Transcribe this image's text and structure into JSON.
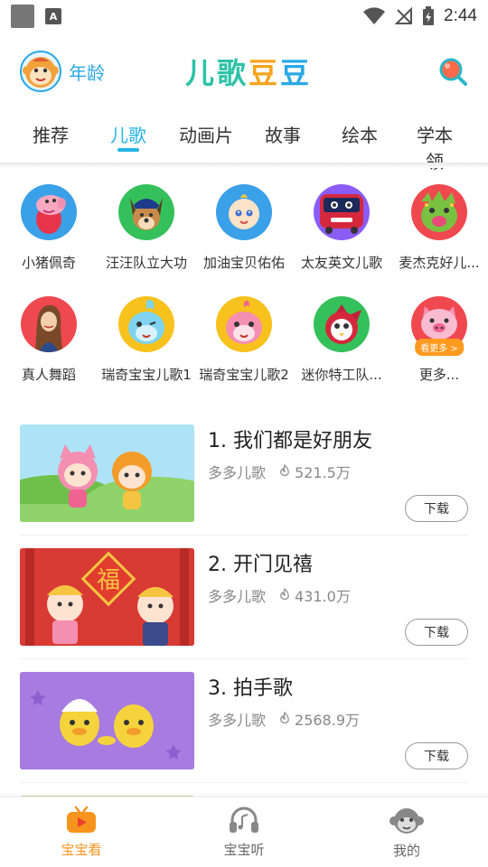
{
  "status": {
    "time": "2:44"
  },
  "header": {
    "age_label": "年龄",
    "logo_chars": [
      "儿",
      "歌",
      "豆",
      "豆"
    ],
    "logo_colors": [
      "#2ec2a6",
      "#2ec2a6",
      "#f7a31d",
      "#2aa8e6"
    ]
  },
  "tabs": [
    {
      "label": "推荐",
      "active": false
    },
    {
      "label": "儿歌",
      "active": true
    },
    {
      "label": "动画片",
      "active": false
    },
    {
      "label": "故事",
      "active": false
    },
    {
      "label": "绘本",
      "active": false
    },
    {
      "label": "学本领",
      "active": false
    }
  ],
  "categories": [
    {
      "label": "小猪佩奇",
      "bg": "#3aa0e8",
      "icon": "peppa-pig-icon"
    },
    {
      "label": "汪汪队立大功",
      "bg": "#34c05a",
      "icon": "paw-patrol-dog-icon"
    },
    {
      "label": "加油宝贝佑佑",
      "bg": "#3aa0e8",
      "icon": "baby-yoyo-icon"
    },
    {
      "label": "太友英文儿歌",
      "bg": "#8b5cf6",
      "icon": "tayo-bus-icon"
    },
    {
      "label": "麦杰克好儿...",
      "bg": "#f0484f",
      "icon": "green-monster-icon"
    },
    {
      "label": "真人舞蹈",
      "bg": "#f0484f",
      "icon": "dancing-girl-icon"
    },
    {
      "label": "瑞奇宝宝儿歌1",
      "bg": "#f7c21d",
      "icon": "rikki-blue-icon"
    },
    {
      "label": "瑞奇宝宝儿歌2",
      "bg": "#f7c21d",
      "icon": "rikki-pink-icon"
    },
    {
      "label": "迷你特工队...",
      "bg": "#34c05a",
      "icon": "mini-force-bird-icon"
    },
    {
      "label": "更多...",
      "bg": "#f0484f",
      "icon": "pink-pig-icon",
      "badge": "看更多 >"
    }
  ],
  "songs": [
    {
      "title": "1. 我们都是好朋友",
      "channel": "多多儿歌",
      "plays": "521.5万",
      "download": "下载",
      "thumb_bg": "#8fd36a",
      "thumb_sky": "#aee3f7"
    },
    {
      "title": "2. 开门见禧",
      "channel": "多多儿歌",
      "plays": "431.0万",
      "download": "下载",
      "thumb_bg": "#d83a34",
      "thumb_sky": "#e44b3f"
    },
    {
      "title": "3. 拍手歌",
      "channel": "多多儿歌",
      "plays": "2568.9万",
      "download": "下载",
      "thumb_bg": "#a77be0",
      "thumb_sky": "#b48de8"
    }
  ],
  "bottom_nav": [
    {
      "label": "宝宝看",
      "icon": "tv-play-icon",
      "active": true
    },
    {
      "label": "宝宝听",
      "icon": "headphones-icon",
      "active": false
    },
    {
      "label": "我的",
      "icon": "monkey-face-icon",
      "active": false
    }
  ]
}
